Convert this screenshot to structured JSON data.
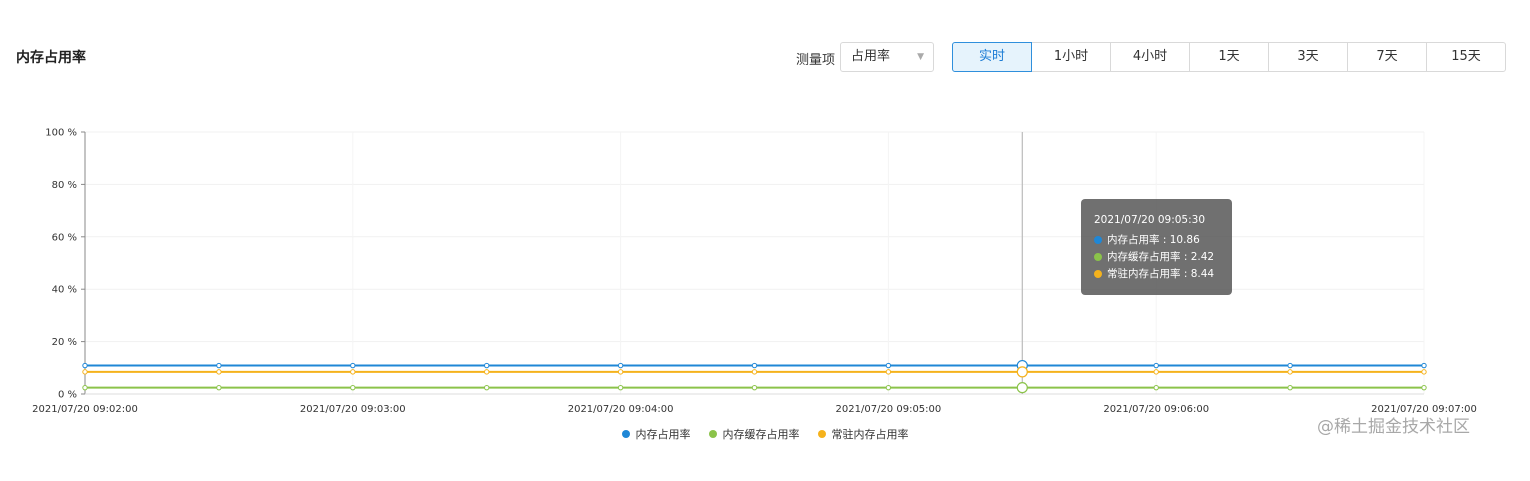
{
  "panel": {
    "title": "内存占用率"
  },
  "controls": {
    "measure_label": "测量项",
    "measure_selected": "占用率",
    "ranges": [
      "实时",
      "1小时",
      "4小时",
      "1天",
      "3天",
      "7天",
      "15天"
    ],
    "active_range": "实时"
  },
  "chart_data": {
    "type": "line",
    "x": [
      "2021/07/20 09:02:00",
      "2021/07/20 09:02:30",
      "2021/07/20 09:03:00",
      "2021/07/20 09:03:30",
      "2021/07/20 09:04:00",
      "2021/07/20 09:04:30",
      "2021/07/20 09:05:00",
      "2021/07/20 09:05:30",
      "2021/07/20 09:06:00",
      "2021/07/20 09:06:30",
      "2021/07/20 09:07:00"
    ],
    "x_ticks": [
      "2021/07/20 09:02:00",
      "2021/07/20 09:03:00",
      "2021/07/20 09:04:00",
      "2021/07/20 09:05:00",
      "2021/07/20 09:06:00",
      "2021/07/20 09:07:00"
    ],
    "y_ticks": [
      "0 %",
      "20 %",
      "40 %",
      "60 %",
      "80 %",
      "100 %"
    ],
    "ylim": [
      0,
      100
    ],
    "series": [
      {
        "name": "内存占用率",
        "color": "#1f87d6",
        "values": [
          10.86,
          10.86,
          10.86,
          10.86,
          10.86,
          10.86,
          10.86,
          10.86,
          10.86,
          10.86,
          10.86
        ]
      },
      {
        "name": "内存缓存占用率",
        "color": "#8bc34a",
        "values": [
          2.42,
          2.42,
          2.42,
          2.42,
          2.42,
          2.42,
          2.42,
          2.42,
          2.42,
          2.42,
          2.42
        ]
      },
      {
        "name": "常驻内存占用率",
        "color": "#f5b21c",
        "values": [
          8.44,
          8.44,
          8.44,
          8.44,
          8.44,
          8.44,
          8.44,
          8.44,
          8.44,
          8.44,
          8.44
        ]
      }
    ],
    "hover_index": 7,
    "legend_position": "bottom-center"
  },
  "tooltip": {
    "time": "2021/07/20 09:05:30",
    "rows": [
      {
        "text": "内存占用率 : 10.86",
        "color": "#1f87d6"
      },
      {
        "text": "内存缓存占用率 : 2.42",
        "color": "#8bc34a"
      },
      {
        "text": "常驻内存占用率 : 8.44",
        "color": "#f5b21c"
      }
    ]
  },
  "legend": [
    "内存占用率",
    "内存缓存占用率",
    "常驻内存占用率"
  ],
  "watermark": "@稀土掘金技术社区"
}
